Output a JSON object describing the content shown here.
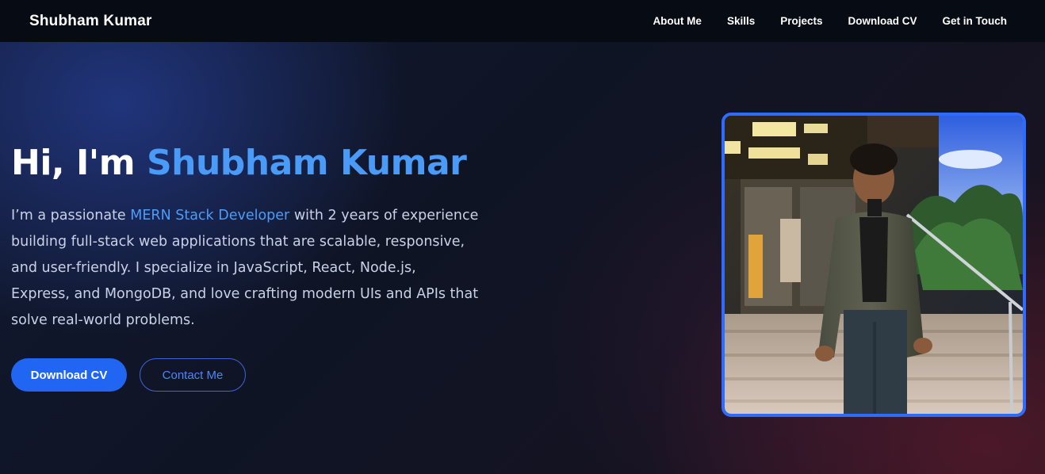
{
  "nav": {
    "brand": "Shubham Kumar",
    "links": [
      "About Me",
      "Skills",
      "Projects",
      "Download CV",
      "Get in Touch"
    ]
  },
  "hero": {
    "title_prefix": "Hi, I'm ",
    "title_name": "Shubham Kumar",
    "desc_prefix": "I’m a passionate ",
    "desc_highlight": "MERN Stack Developer",
    "desc_suffix": " with 2 years of experience building full-stack web applications that are scalable, responsive, and user-friendly. I specialize in JavaScript, React, Node.js, Express, and MongoDB, and love crafting modern UIs and APIs that solve real-world problems.",
    "primary_button": "Download CV",
    "secondary_button": "Contact Me"
  },
  "colors": {
    "accent": "#4a9af7",
    "primary_button": "#2166f3",
    "frame_border": "#2f6bff",
    "nav_background": "#070b14"
  }
}
